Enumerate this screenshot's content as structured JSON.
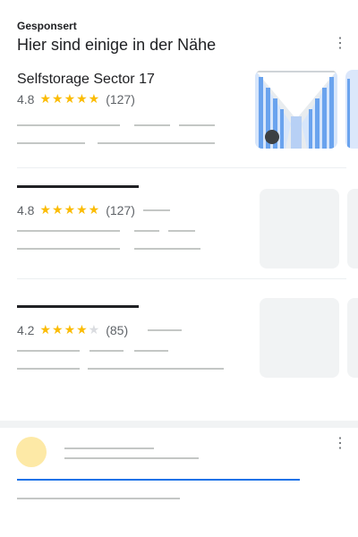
{
  "header": {
    "sponsored_label": "Gesponsert",
    "title": "Hier sind einige in der Nähe",
    "more_icon": "⋮"
  },
  "listings": [
    {
      "name": "Selfstorage Sector 17",
      "rating": "4.8",
      "stars_filled": 5,
      "reviews": "(127)"
    },
    {
      "name": "",
      "rating": "4.8",
      "stars_filled": 5,
      "reviews": "(127)"
    },
    {
      "name": "",
      "rating": "4.2",
      "stars_filled": 4,
      "reviews": "(85)"
    }
  ],
  "stars": {
    "five": "★★★★★",
    "four": "★★★★",
    "empty_one": "★"
  },
  "colors": {
    "star": "#fbbc04",
    "placeholder_line": "#c4c7c5",
    "accent_blue": "#1a73e8",
    "avatar": "#fde9a6"
  },
  "icons": {
    "more": "more-vert-icon",
    "listing_photo": "storage-facility-photo"
  }
}
